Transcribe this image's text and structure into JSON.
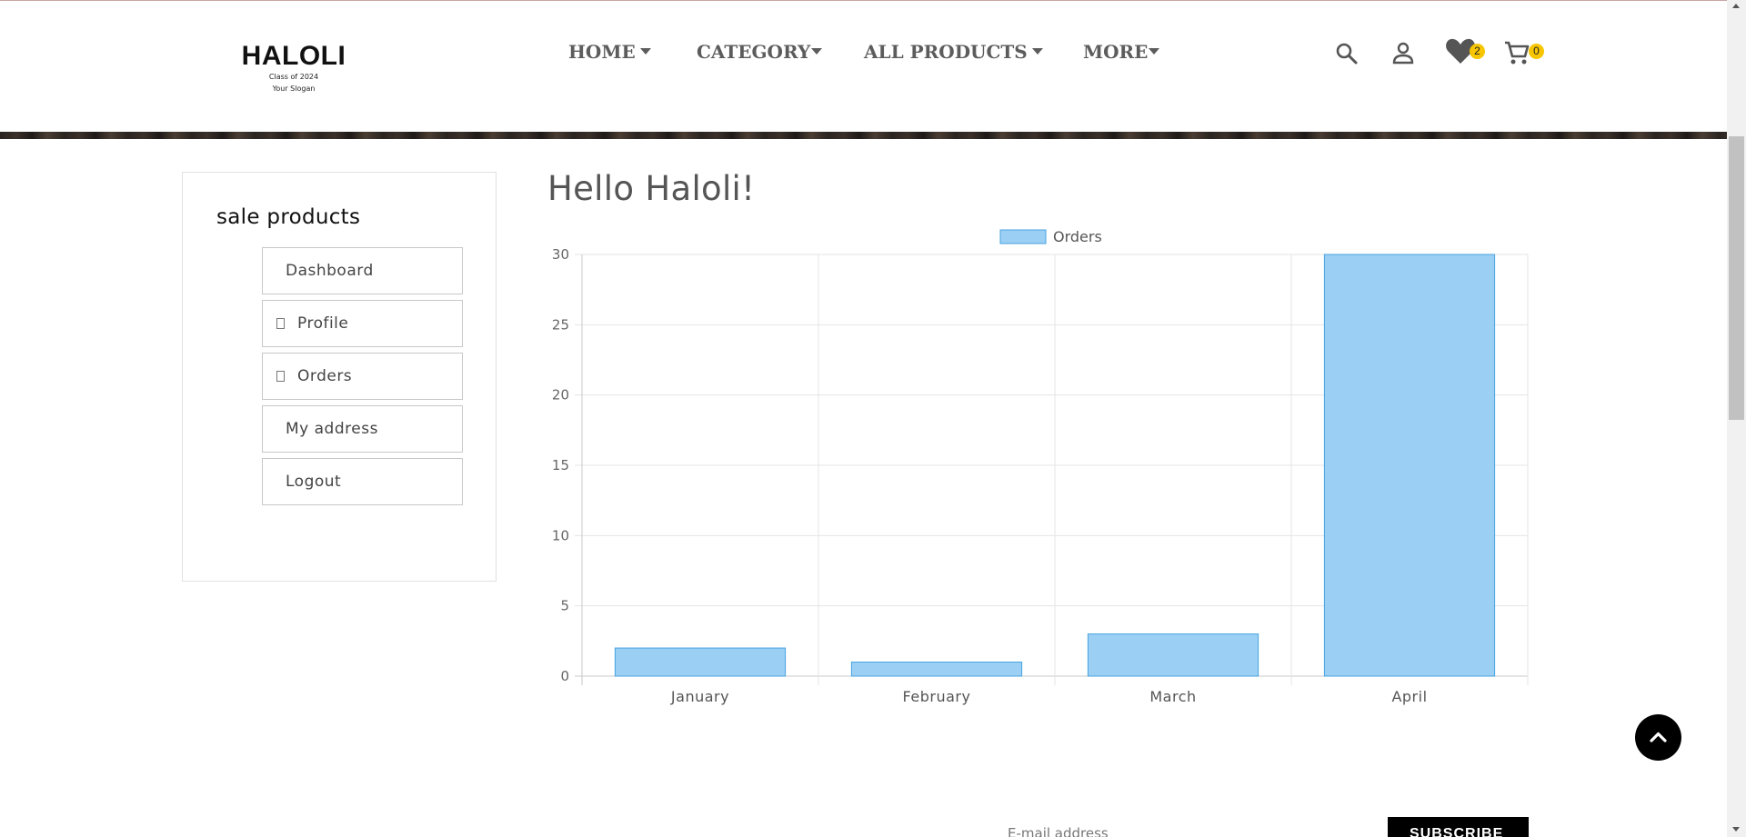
{
  "header": {
    "brand": "HALOLI",
    "brand_line1": "Class of 2024",
    "brand_line2": "Your Slogan",
    "nav": [
      {
        "label": "HOME"
      },
      {
        "label": "CATEGORY"
      },
      {
        "label": "ALL PRODUCTS"
      },
      {
        "label": "MORE"
      }
    ],
    "wishlist_count": "2",
    "cart_count": "0",
    "icons": [
      "search-icon",
      "user-icon",
      "heart-icon",
      "cart-icon"
    ],
    "badge_color": "#f7c600"
  },
  "sidebar": {
    "title": "sale products",
    "items": [
      {
        "label": "Dashboard",
        "icon": ""
      },
      {
        "label": "Profile",
        "icon": "profile-glyph"
      },
      {
        "label": "Orders",
        "icon": "orders-glyph"
      },
      {
        "label": "My address",
        "icon": ""
      },
      {
        "label": "Logout",
        "icon": ""
      }
    ]
  },
  "main": {
    "greeting": "Hello Haloli!"
  },
  "chart_data": {
    "type": "bar",
    "categories": [
      "January",
      "February",
      "March",
      "April"
    ],
    "series": [
      {
        "name": "Orders",
        "values": [
          2,
          1,
          3,
          30
        ]
      }
    ],
    "ylim": [
      0,
      30
    ],
    "yticks": [
      0,
      5,
      10,
      15,
      20,
      25,
      30
    ],
    "grid": true,
    "legend": "top-center",
    "bar_fill": "#9ccff4",
    "bar_stroke": "#47a3e0"
  },
  "footer": {
    "email_placeholder": "E-mail address",
    "subscribe_label": "SUBSCRIBE"
  },
  "colors": {
    "nav_text": "#5c5c5c",
    "to_top_button": "#000000"
  }
}
